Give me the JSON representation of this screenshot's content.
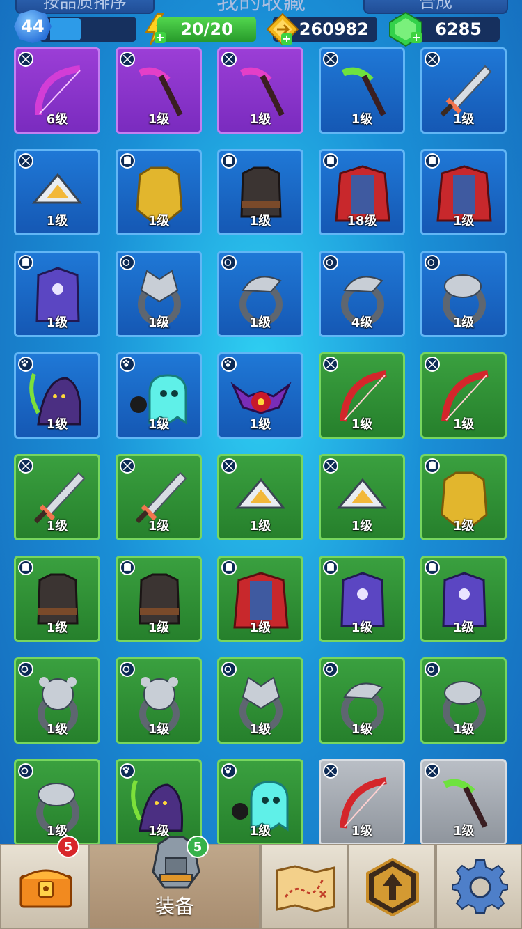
{
  "header": {
    "tab_left": "按品质排序",
    "title": "我的收藏",
    "tab_right": "合成",
    "player_level": "44",
    "xp_progress": 0.35,
    "energy": "20/20",
    "coins": "260982",
    "gems": "6285"
  },
  "slots": {
    "weapon": "crossed-swords-icon",
    "armor": "armor-icon",
    "ring": "ring-icon",
    "pet": "paw-icon"
  },
  "items": [
    {
      "rarity": "purple",
      "slot": "weapon",
      "art": "bow",
      "level": "6级"
    },
    {
      "rarity": "purple",
      "slot": "weapon",
      "art": "scythe-pink",
      "level": "1级"
    },
    {
      "rarity": "purple",
      "slot": "weapon",
      "art": "scythe-pink",
      "level": "1级"
    },
    {
      "rarity": "blue",
      "slot": "weapon",
      "art": "scythe-green",
      "level": "1级"
    },
    {
      "rarity": "blue",
      "slot": "weapon",
      "art": "sword",
      "level": "1级"
    },
    {
      "rarity": "blue",
      "slot": "weapon",
      "art": "shuriken",
      "level": "1级"
    },
    {
      "rarity": "blue",
      "slot": "armor",
      "art": "gold-armor",
      "level": "1级"
    },
    {
      "rarity": "blue",
      "slot": "armor",
      "art": "dark-vest",
      "level": "1级"
    },
    {
      "rarity": "blue",
      "slot": "armor",
      "art": "red-cape",
      "level": "18级"
    },
    {
      "rarity": "blue",
      "slot": "armor",
      "art": "red-cape",
      "level": "1级"
    },
    {
      "rarity": "blue",
      "slot": "armor",
      "art": "purple-robe",
      "level": "1级"
    },
    {
      "rarity": "blue",
      "slot": "ring",
      "art": "wolf-ring",
      "level": "1级"
    },
    {
      "rarity": "blue",
      "slot": "ring",
      "art": "eagle-ring",
      "level": "1级"
    },
    {
      "rarity": "blue",
      "slot": "ring",
      "art": "eagle-ring",
      "level": "4级"
    },
    {
      "rarity": "blue",
      "slot": "ring",
      "art": "snake-ring",
      "level": "1级"
    },
    {
      "rarity": "blue",
      "slot": "pet",
      "art": "reaper",
      "level": "1级"
    },
    {
      "rarity": "blue",
      "slot": "pet",
      "art": "ghost",
      "level": "1级"
    },
    {
      "rarity": "blue",
      "slot": "pet",
      "art": "bat",
      "level": "1级"
    },
    {
      "rarity": "green",
      "slot": "weapon",
      "art": "bow-red",
      "level": "1级"
    },
    {
      "rarity": "green",
      "slot": "weapon",
      "art": "bow-red",
      "level": "1级"
    },
    {
      "rarity": "green",
      "slot": "weapon",
      "art": "sword",
      "level": "1级"
    },
    {
      "rarity": "green",
      "slot": "weapon",
      "art": "sword",
      "level": "1级"
    },
    {
      "rarity": "green",
      "slot": "weapon",
      "art": "shuriken",
      "level": "1级"
    },
    {
      "rarity": "green",
      "slot": "weapon",
      "art": "shuriken",
      "level": "1级"
    },
    {
      "rarity": "green",
      "slot": "armor",
      "art": "gold-armor",
      "level": "1级"
    },
    {
      "rarity": "green",
      "slot": "armor",
      "art": "dark-vest",
      "level": "1级"
    },
    {
      "rarity": "green",
      "slot": "armor",
      "art": "dark-vest",
      "level": "1级"
    },
    {
      "rarity": "green",
      "slot": "armor",
      "art": "red-cape",
      "level": "1级"
    },
    {
      "rarity": "green",
      "slot": "armor",
      "art": "purple-robe",
      "level": "1级"
    },
    {
      "rarity": "green",
      "slot": "armor",
      "art": "purple-robe",
      "level": "1级"
    },
    {
      "rarity": "green",
      "slot": "ring",
      "art": "bear-ring",
      "level": "1级"
    },
    {
      "rarity": "green",
      "slot": "ring",
      "art": "bear-ring",
      "level": "1级"
    },
    {
      "rarity": "green",
      "slot": "ring",
      "art": "wolf-ring",
      "level": "1级"
    },
    {
      "rarity": "green",
      "slot": "ring",
      "art": "eagle-ring",
      "level": "1级"
    },
    {
      "rarity": "green",
      "slot": "ring",
      "art": "snake-ring",
      "level": "1级"
    },
    {
      "rarity": "green",
      "slot": "ring",
      "art": "snake-ring",
      "level": "1级"
    },
    {
      "rarity": "green",
      "slot": "pet",
      "art": "reaper",
      "level": "1级"
    },
    {
      "rarity": "green",
      "slot": "pet",
      "art": "ghost",
      "level": "1级"
    },
    {
      "rarity": "gray",
      "slot": "weapon",
      "art": "bow-red",
      "level": "1级"
    },
    {
      "rarity": "gray",
      "slot": "weapon",
      "art": "scythe-green",
      "level": "1级"
    }
  ],
  "bottom_nav": {
    "chest_badge": "5",
    "equip_label": "装备",
    "equip_badge": "5",
    "icons": [
      "treasure-chest-icon",
      "armor-icon",
      "map-icon",
      "upgrade-arrow-icon",
      "gear-icon"
    ]
  }
}
